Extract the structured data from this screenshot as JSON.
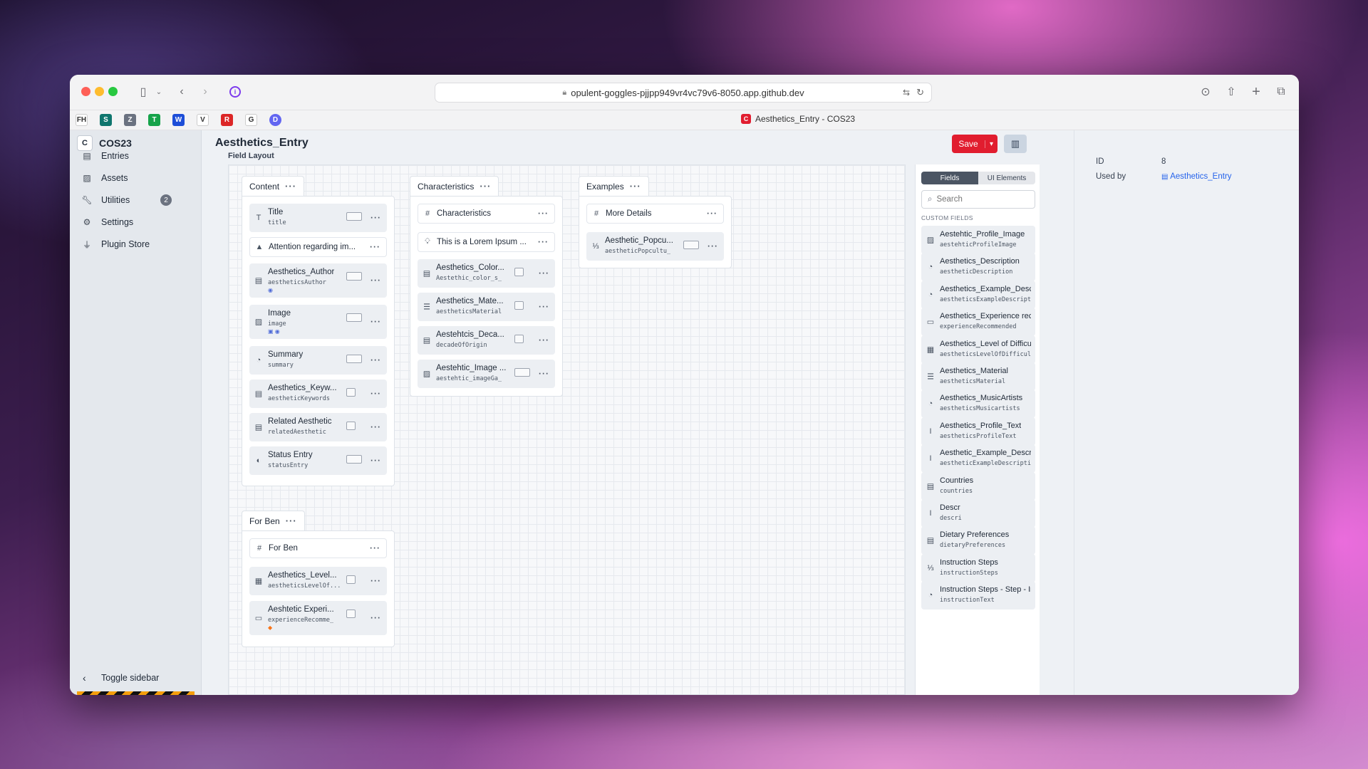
{
  "browser": {
    "url": "opulent-goggles-pjjpp949vr4vc79v6-8050.app.github.dev",
    "tab_title": "Aesthetics_Entry - COS23",
    "tab_icon": "C"
  },
  "bookmarks": [
    "FH",
    "S",
    "Z",
    "T",
    "W",
    "V",
    "R",
    "G",
    "D"
  ],
  "colors": {
    "accent": "#e11d2f",
    "link": "#2563eb"
  },
  "sidebar": {
    "site_initial": "C",
    "site_name": "COS23",
    "items": [
      {
        "label": "Entries",
        "icon": "entries-icon"
      },
      {
        "label": "Assets",
        "icon": "assets-icon"
      },
      {
        "label": "Utilities",
        "icon": "wrench-icon",
        "badge": "2"
      },
      {
        "label": "Settings",
        "icon": "gear-icon"
      },
      {
        "label": "Plugin Store",
        "icon": "plug-icon"
      }
    ],
    "toggle_label": "Toggle sidebar"
  },
  "header": {
    "title": "Aesthetics_Entry",
    "save_label": "Save"
  },
  "layout": {
    "label": "Field Layout",
    "tabs": [
      {
        "name": "Content",
        "fields": [
          {
            "name": "Title",
            "handle": "title",
            "icon": "text-icon"
          },
          {
            "name": "Attention regarding im...",
            "icon": "warning-icon",
            "ui": true
          },
          {
            "name": "Aesthetics_Author",
            "handle": "aestheticsAuthor",
            "icon": "entries-icon",
            "mark": "◉"
          },
          {
            "name": "Image",
            "handle": "image",
            "icon": "image-icon",
            "mark": "▣ ◉"
          },
          {
            "name": "Summary",
            "handle": "summary",
            "icon": "richtext-icon"
          },
          {
            "name": "Aesthetics_Keyw...",
            "handle": "aestheticKeywords",
            "icon": "entries-icon"
          },
          {
            "name": "Related Aesthetic",
            "handle": "relatedAesthetic",
            "icon": "entries-icon"
          },
          {
            "name": "Status Entry",
            "handle": "statusEntry",
            "icon": "toggle-icon"
          }
        ]
      },
      {
        "name": "Characteristics",
        "fields": [
          {
            "name": "Characteristics",
            "icon": "hash-icon",
            "ui": true
          },
          {
            "name": "This is a Lorem Ipsum ...",
            "icon": "tip-icon",
            "ui": true
          },
          {
            "name": "Aesthetics_Color...",
            "handle": "Aestethic_color_s_",
            "icon": "entries-icon"
          },
          {
            "name": "Aesthetics_Mate...",
            "handle": "aestheticsMaterial",
            "icon": "checklist-icon"
          },
          {
            "name": "Aestehtcis_Deca...",
            "handle": "decadeOfOrigin",
            "icon": "entries-icon"
          },
          {
            "name": "Aestehtic_Image ...",
            "handle": "aestehtic_imageGa_",
            "icon": "image-icon"
          }
        ]
      },
      {
        "name": "Examples",
        "fields": [
          {
            "name": "More Details",
            "icon": "hash-icon",
            "ui": true
          },
          {
            "name": "Aesthetic_Popcu...",
            "handle": "aestheticPopcultu_",
            "icon": "numbered-list-icon"
          }
        ]
      },
      {
        "name": "For Ben",
        "fields": [
          {
            "name": "For Ben",
            "icon": "hash-icon",
            "ui": true
          },
          {
            "name": "Aesthetics_Level...",
            "handle": "aestheticsLevelOf...",
            "icon": "table-icon"
          },
          {
            "name": "Aeshtetic Experi...",
            "handle": "experienceRecomme_",
            "icon": "dropdown-icon",
            "mark": "◆"
          }
        ]
      }
    ]
  },
  "library": {
    "tabs": [
      "Fields",
      "UI Elements"
    ],
    "search_placeholder": "Search",
    "section": "CUSTOM FIELDS",
    "fields": [
      {
        "name": "Aestehtic_Profile_Image",
        "handle": "aestehticProfileImage",
        "icon": "image-icon"
      },
      {
        "name": "Aesthetics_Description",
        "handle": "aestheticDescription",
        "icon": "richtext-icon"
      },
      {
        "name": "Aesthetics_Example_Descri...",
        "handle": "aestheticsExampleDescription",
        "icon": "richtext-icon"
      },
      {
        "name": "Aesthetics_Experience reco...",
        "handle": "experienceRecommended",
        "icon": "dropdown-icon"
      },
      {
        "name": "Aesthetics_Level of Difficulty",
        "handle": "aestheticsLevelOfDifficulty",
        "icon": "table-icon"
      },
      {
        "name": "Aesthetics_Material",
        "handle": "aestheticsMaterial",
        "icon": "checklist-icon"
      },
      {
        "name": "Aesthetics_MusicArtists",
        "handle": "aestheticsMusicartists",
        "icon": "richtext-icon"
      },
      {
        "name": "Aesthetics_Profile_Text",
        "handle": "aestheticsProfileText",
        "icon": "plaintext-icon"
      },
      {
        "name": "Aesthetic_Example_Descrip...",
        "handle": "aestheticExampleDescription",
        "icon": "plaintext-icon"
      },
      {
        "name": "Countries",
        "handle": "countries",
        "icon": "entries-icon"
      },
      {
        "name": "Descr",
        "handle": "descri",
        "icon": "plaintext-icon"
      },
      {
        "name": "Dietary Preferences",
        "handle": "dietaryPreferences",
        "icon": "entries-icon"
      },
      {
        "name": "Instruction Steps",
        "handle": "instructionSteps",
        "icon": "numbered-list-icon"
      },
      {
        "name": "Instruction Steps - Step - In...",
        "handle": "instructionText",
        "icon": "richtext-icon"
      }
    ]
  },
  "meta": {
    "id_label": "ID",
    "id_value": "8",
    "used_by_label": "Used by",
    "used_by_value": "Aesthetics_Entry"
  }
}
